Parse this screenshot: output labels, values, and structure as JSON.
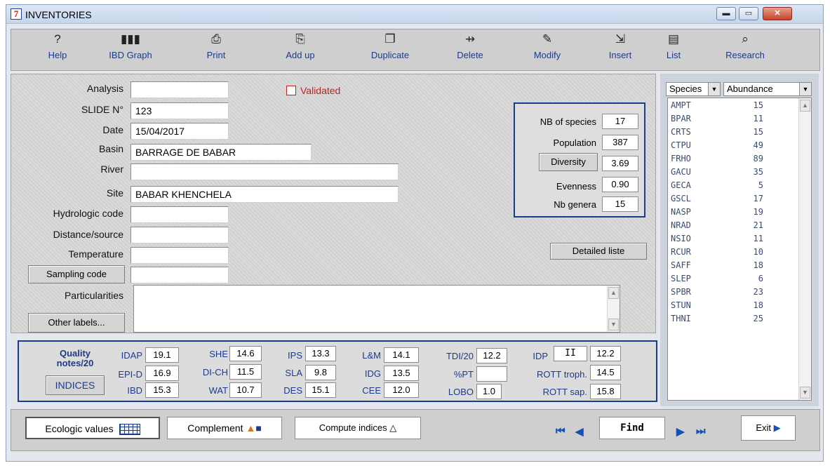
{
  "window": {
    "title": "INVENTORIES",
    "app_icon": "7"
  },
  "toolbar": [
    {
      "label": "Help",
      "icon": "?"
    },
    {
      "label": "IBD Graph",
      "icon": "▮▮▮"
    },
    {
      "label": "Print",
      "icon": "⎙"
    },
    {
      "label": "Add up",
      "icon": "⎘"
    },
    {
      "label": "Duplicate",
      "icon": "❐"
    },
    {
      "label": "Delete",
      "icon": "⇸"
    },
    {
      "label": "Modify",
      "icon": "✎"
    },
    {
      "label": "Insert",
      "icon": "⇲"
    },
    {
      "label": "List",
      "icon": "▤"
    },
    {
      "label": "Research",
      "icon": "⌕"
    }
  ],
  "form": {
    "analysis_label": "Analysis",
    "analysis_value": "",
    "slide_label": "SLIDE N°",
    "slide_value": "123",
    "date_label": "Date",
    "date_value": "15/04/2017",
    "basin_label": "Basin",
    "basin_value": "BARRAGE DE BABAR",
    "river_label": "River",
    "river_value": "",
    "site_label": "Site",
    "site_value": "BABAR KHENCHELA",
    "hydro_label": "Hydrologic code",
    "hydro_value": "",
    "distance_label": "Distance/source",
    "distance_value": "",
    "temperature_label": "Temperature",
    "temperature_value": "",
    "sampling_button": "Sampling code",
    "sampling_value": "",
    "particularities_label": "Particularities",
    "other_labels_button": "Other labels...",
    "validated_label": "Validated",
    "validated_checked": false,
    "detailed_button": "Detailed liste"
  },
  "stats": {
    "nb_species_label": "NB of species",
    "nb_species": "17",
    "population_label": "Population",
    "population": "387",
    "diversity_button": "Diversity",
    "diversity": "3.69",
    "evenness_label": "Evenness",
    "evenness": "0.90",
    "nb_genera_label": "Nb genera",
    "nb_genera": "15"
  },
  "indices": {
    "quality_title": "Quality notes/20",
    "indices_button": "INDICES",
    "idap_label": "IDAP",
    "idap": "19.1",
    "epid_label": "EPI-D",
    "epid": "16.9",
    "ibd_label": "IBD",
    "ibd": "15.3",
    "she_label": "SHE",
    "she": "14.6",
    "dich_label": "DI-CH",
    "dich": "11.5",
    "wat_label": "WAT",
    "wat": "10.7",
    "ips_label": "IPS",
    "ips": "13.3",
    "sla_label": "SLA",
    "sla": "9.8",
    "des_label": "DES",
    "des": "15.1",
    "lm_label": "L&M",
    "lm": "14.1",
    "idg_label": "IDG",
    "idg": "13.5",
    "cee_label": "CEE",
    "cee": "12.0",
    "tdi_label": "TDI/20",
    "tdi": "12.2",
    "pt_label": "%PT",
    "pt": "",
    "lobo_label": "LOBO",
    "lobo": "1.0",
    "idp_label": "IDP",
    "idp_class": "II",
    "idp": "12.2",
    "rott_troph_label": "ROTT troph.",
    "rott_troph": "14.5",
    "rott_sap_label": "ROTT sap.",
    "rott_sap": "15.8"
  },
  "species_panel": {
    "col1_header": "Species",
    "col2_header": "Abundance",
    "rows": [
      {
        "code": "AMPT",
        "abundance": "15"
      },
      {
        "code": "BPAR",
        "abundance": "11"
      },
      {
        "code": "CRTS",
        "abundance": "15"
      },
      {
        "code": "CTPU",
        "abundance": "49"
      },
      {
        "code": "FRHO",
        "abundance": "89"
      },
      {
        "code": "GACU",
        "abundance": "35"
      },
      {
        "code": "GECA",
        "abundance": "5"
      },
      {
        "code": "GSCL",
        "abundance": "17"
      },
      {
        "code": "NASP",
        "abundance": "19"
      },
      {
        "code": "NRAD",
        "abundance": "21"
      },
      {
        "code": "NSIO",
        "abundance": "11"
      },
      {
        "code": "RCUR",
        "abundance": "10"
      },
      {
        "code": "SAFF",
        "abundance": "18"
      },
      {
        "code": "SLEP",
        "abundance": "6"
      },
      {
        "code": "SPBR",
        "abundance": "23"
      },
      {
        "code": "STUN",
        "abundance": "18"
      },
      {
        "code": "THNI",
        "abundance": "25"
      }
    ]
  },
  "bottom": {
    "ecologic_button": "Ecologic values",
    "complement_button": "Complement",
    "compute_button": "Compute indices",
    "find_button": "Find",
    "exit_button": "Exit"
  }
}
